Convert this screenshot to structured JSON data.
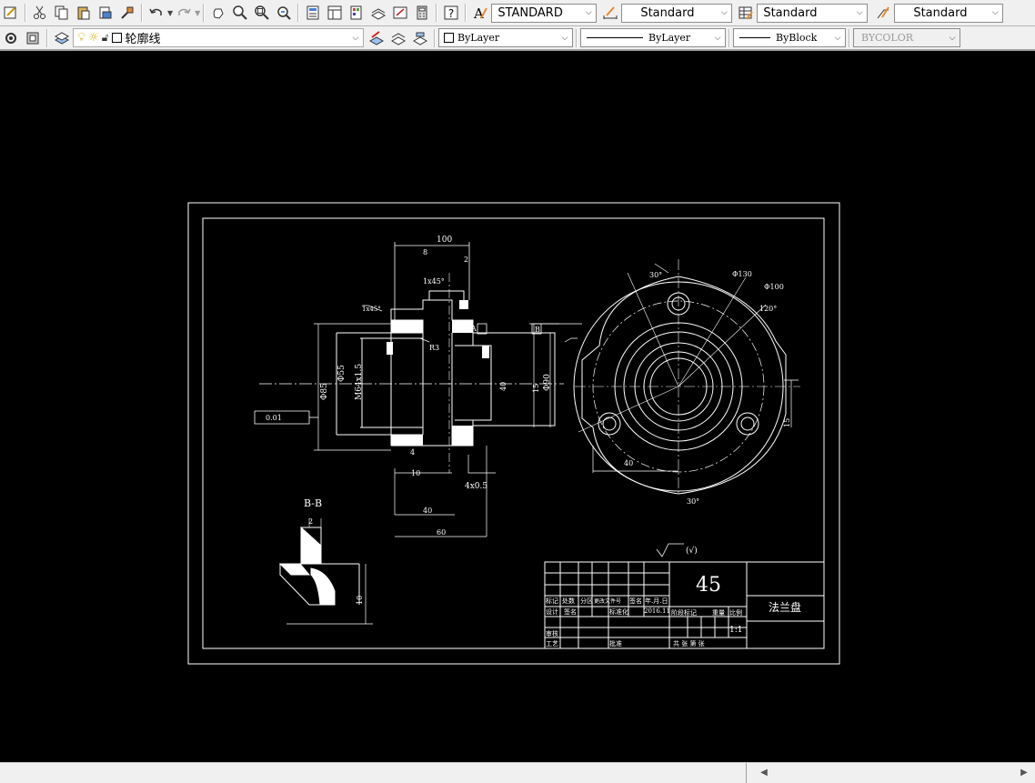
{
  "toolbar_styles": {
    "text_style": "STANDARD",
    "dim_style": "Standard",
    "table_style": "Standard",
    "multileader_style": "Standard"
  },
  "toolbar_layers": {
    "current_layer": "轮廓线",
    "color": "ByLayer",
    "linetype": "ByLayer",
    "lineweight": "ByBlock",
    "plot_style": "BYCOLOR"
  },
  "drawing": {
    "section_label": "B-B",
    "chamfer_label_1": "4x0.5",
    "surface_note": "(√)",
    "material": "45",
    "part_name": "法兰盘",
    "scale": "1:1",
    "date": "2016.11",
    "title_block": {
      "row_headers": [
        "标记",
        "处数",
        "分区",
        "更改文件号",
        "签名",
        "年.月.日"
      ],
      "design": "设计",
      "standard": "标准化",
      "review": "审核",
      "process": "工艺",
      "approve": "批准",
      "stage_mark": "阶段标记",
      "weight": "重量",
      "ratio": "比例",
      "sheets": "共  张  第  张",
      "signature": "签名"
    },
    "dims": {
      "d1": "8",
      "d2": "15",
      "d3": "10",
      "d4": "2",
      "d5": "100",
      "d6": "40",
      "d7": "60",
      "d8": "4",
      "d9": "R3",
      "d10": "1x45°",
      "d11": "0.01",
      "d12": "A",
      "d13": "B",
      "d14": "Φ85",
      "d15": "Φ130",
      "d16": "Φ100",
      "d17": "120°",
      "d18": "Φ90",
      "d19": "M64x1.5",
      "d20": "Φ55",
      "d21": "30°"
    }
  },
  "colors": {
    "toolbar_bg": "#f0f0f0",
    "canvas_bg": "#000000",
    "drawing_lines": "#ffffff"
  }
}
